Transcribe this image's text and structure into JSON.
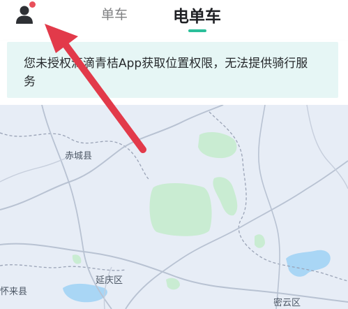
{
  "header": {
    "tabs": [
      {
        "label": "单车",
        "active": false
      },
      {
        "label": "电单车",
        "active": true
      }
    ],
    "accent_color": "#2bbf9a",
    "avatar_icon": "user-icon"
  },
  "notice": {
    "text": "您未授权滴滴青桔App获取位置权限，无法提供骑行服务"
  },
  "map": {
    "labels": [
      "赤城县",
      "延庆区",
      "怀来县",
      "密云区"
    ]
  },
  "annotation": {
    "arrow_color": "#e23a4a"
  }
}
